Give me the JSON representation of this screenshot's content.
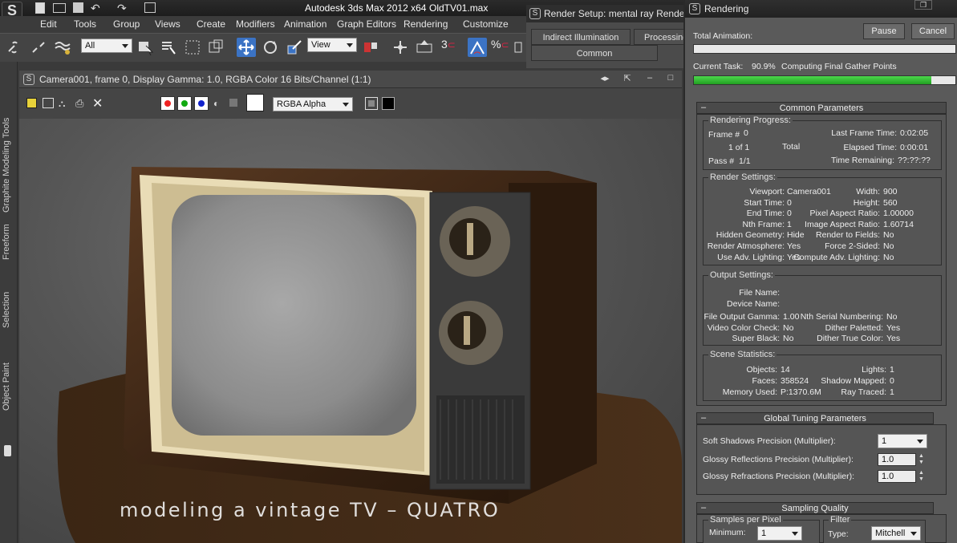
{
  "app": {
    "title": "Autodesk 3ds Max  2012 x64",
    "file": "OldTV01.max"
  },
  "menu": [
    "Edit",
    "Tools",
    "Group",
    "Views",
    "Create",
    "Modifiers",
    "Animation",
    "Graph Editors",
    "Rendering",
    "Customize"
  ],
  "toolbar": {
    "selection_filter": "All",
    "ref_coord": "View",
    "snap_label": "3"
  },
  "left_tabs": [
    "Graphite Modeling Tools",
    "Freeform",
    "Selection",
    "Object Paint"
  ],
  "vfb": {
    "title": "Camera001, frame 0, Display Gamma: 1.0, RGBA Color 16 Bits/Channel (1:1)",
    "channel": "RGBA Alpha",
    "overlay_text": "modeling a vintage TV – QUATRO"
  },
  "render_setup": {
    "title": "Render Setup: mental ray Renderer",
    "tabs": [
      "Indirect Illumination",
      "Processing",
      "Common"
    ]
  },
  "rendering": {
    "title": "Rendering",
    "pause": "Pause",
    "cancel": "Cancel",
    "total_animation_label": "Total Animation:",
    "total_progress": 0.0,
    "current_task_label": "Current Task:",
    "current_task_pct": "90.9%",
    "current_task_text": "Computing Final Gather Points",
    "current_progress": 0.909,
    "common_params": "Common Parameters",
    "progress": {
      "label": "Rendering Progress:",
      "frame_label": "Frame #",
      "frame": "0",
      "of": "1 of 1",
      "total": "Total",
      "pass_label": "Pass #",
      "pass": "1/1",
      "last_frame_label": "Last Frame Time:",
      "last_frame": "0:02:05",
      "elapsed_label": "Elapsed Time:",
      "elapsed": "0:00:01",
      "remaining_label": "Time Remaining:",
      "remaining": "??:??:??"
    },
    "render_settings": {
      "label": "Render Settings:",
      "left": [
        [
          "Viewport:",
          "Camera001"
        ],
        [
          "Start Time:",
          "0"
        ],
        [
          "End Time:",
          "0"
        ],
        [
          "Nth Frame:",
          "1"
        ],
        [
          "Hidden Geometry:",
          "Hide"
        ],
        [
          "Render Atmosphere:",
          "Yes"
        ],
        [
          "Use Adv. Lighting:",
          "Yes"
        ]
      ],
      "right": [
        [
          "Width:",
          "900"
        ],
        [
          "Height:",
          "560"
        ],
        [
          "Pixel Aspect Ratio:",
          "1.00000"
        ],
        [
          "Image Aspect Ratio:",
          "1.60714"
        ],
        [
          "Render to Fields:",
          "No"
        ],
        [
          "Force 2-Sided:",
          "No"
        ],
        [
          "Compute Adv. Lighting:",
          "No"
        ]
      ]
    },
    "output_settings": {
      "label": "Output Settings:",
      "file_name": "File Name:",
      "device_name": "Device Name:",
      "left": [
        [
          "File Output Gamma:",
          "1.00"
        ],
        [
          "Video Color Check:",
          "No"
        ],
        [
          "Super Black:",
          "No"
        ]
      ],
      "right": [
        [
          "Nth Serial Numbering:",
          "No"
        ],
        [
          "Dither Paletted:",
          "Yes"
        ],
        [
          "Dither True Color:",
          "Yes"
        ]
      ]
    },
    "scene_stats": {
      "label": "Scene Statistics:",
      "left": [
        [
          "Objects:",
          "14"
        ],
        [
          "Faces:",
          "358524"
        ],
        [
          "Memory Used:",
          "P:1370.6M"
        ]
      ],
      "right": [
        [
          "Lights:",
          "1"
        ],
        [
          "Shadow Mapped:",
          "0"
        ],
        [
          "Ray Traced:",
          "1"
        ]
      ]
    },
    "global_tuning": {
      "label": "Global Tuning Parameters",
      "soft_shadows_label": "Soft Shadows Precision (Multiplier):",
      "soft_shadows": "1",
      "glossy_reflections_label": "Glossy Reflections Precision (Multiplier):",
      "glossy_reflections": "1.0",
      "glossy_refractions_label": "Glossy Refractions Precision (Multiplier):",
      "glossy_refractions": "1.0"
    },
    "sampling": {
      "label": "Sampling Quality",
      "samples_label": "Samples per Pixel",
      "minimum_label": "Minimum:",
      "minimum": "1",
      "filter_label": "Filter",
      "type_label": "Type:",
      "type": "Mitchell"
    }
  }
}
